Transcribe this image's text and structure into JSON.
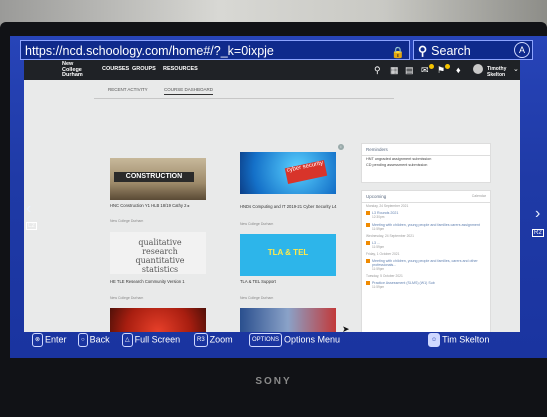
{
  "browser": {
    "url": "https://ncd.schoology.com/home#/?_k=0ixpje",
    "search_label": "Search",
    "home_button": "A"
  },
  "schoology": {
    "logo_text": [
      "New",
      "College",
      "Durham"
    ],
    "nav": [
      "COURSES",
      "GROUPS",
      "RESOURCES"
    ],
    "user_name": "Timothy Skelton",
    "tabs": [
      "RECENT ACTIVITY",
      "COURSE DASHBOARD"
    ],
    "tiles": [
      {
        "image_text": "CONSTRUCTION",
        "title": "HNC Construction Y1 HLB 18/19 Cathy 2 ▸",
        "org": "New College Durham"
      },
      {
        "image_text": "cyber security",
        "title": "HNDs Computing and IT 2019-21 Cyber Security L4",
        "org": "New College Durham"
      },
      {
        "image_text": "qualitative research quantitative statistics",
        "title": "HE TLE Research Community Version 1",
        "org": "New College Durham"
      },
      {
        "image_text": "TLA & TEL",
        "title": "TLA & TEL Support",
        "org": "New College Durham"
      }
    ],
    "reminders": {
      "title": "Reminders",
      "items": [
        "HNT ungraded assignment submission",
        "CD pending assessment submission"
      ]
    },
    "upcoming": {
      "title": "Upcoming",
      "calendar_label": "Calendar",
      "events": [
        {
          "date": "Monday, 24 September 2021",
          "title": "L3 Rounds 2021",
          "time": "12:30pm"
        },
        {
          "date": "",
          "title": "Meeting with children, young people and families carers assignment",
          "time": "11:59pm"
        },
        {
          "date": "Wednesday, 24 September 2021",
          "title": "L3 ...",
          "time": "11:59pm"
        },
        {
          "date": "Friday, 1 October 2021",
          "title": "Meeting with children, young people and families, carers and other professionals...",
          "time": "11:59pm"
        },
        {
          "date": "Tuesday, 5 October 2021",
          "title": "Practice Assessment (SLMS) (W1) Sub",
          "time": "11:59pm"
        }
      ]
    }
  },
  "controls": [
    {
      "key": "⊗",
      "label": "Enter"
    },
    {
      "key": "○",
      "label": "Back"
    },
    {
      "key": "△",
      "label": "Full Screen"
    },
    {
      "key": "R3",
      "label": "Zoom"
    },
    {
      "key": "OPTIONS",
      "label": "Options Menu"
    }
  ],
  "status_user": "Tim Skelton",
  "side_labels": {
    "left": "L2",
    "right": "R2"
  },
  "tv_brand": "SONY",
  "colors": {
    "ps_blue": "#1f3aa6",
    "schoology_nav": "#1f2226",
    "accent_yellow": "#f5c400"
  }
}
